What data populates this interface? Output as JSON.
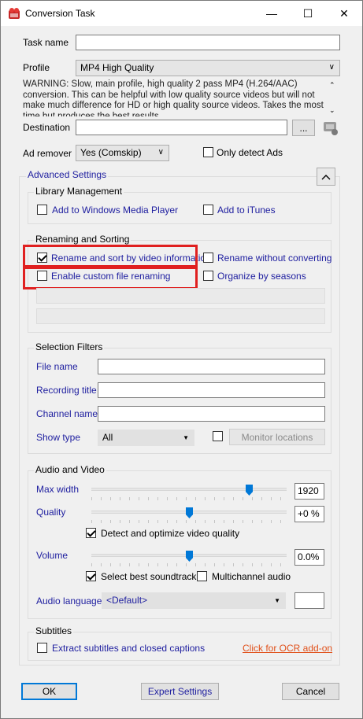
{
  "window": {
    "title": "Conversion Task",
    "minimize": "—",
    "maximize": "☐",
    "close": "✕"
  },
  "task_name": {
    "label": "Task name",
    "value": ""
  },
  "profile": {
    "label": "Profile",
    "value": "MP4 High Quality",
    "description": "WARNING: Slow, main profile, high quality 2 pass MP4 (H.264/AAC) conversion. This can be helpful with low quality source videos but will not make much difference for HD or high quality source videos. Takes the most time but produces the best results."
  },
  "destination": {
    "label": "Destination",
    "value": "",
    "browse": "..."
  },
  "ad_remover": {
    "label": "Ad remover",
    "value": "Yes (Comskip)",
    "only_detect": "Only detect Ads"
  },
  "advanced": {
    "label": "Advanced Settings",
    "collapse": "^"
  },
  "library": {
    "title": "Library Management",
    "wmp": "Add to Windows Media Player",
    "itunes": "Add to iTunes"
  },
  "renaming": {
    "title": "Renaming and Sorting",
    "rename_sort": "Rename and sort by video information",
    "rename_without": "Rename without converting",
    "custom": "Enable custom file renaming",
    "organize": "Organize by seasons"
  },
  "filters": {
    "title": "Selection Filters",
    "file_name": "File name",
    "recording_title": "Recording title",
    "channel_name": "Channel name",
    "show_type": "Show type",
    "show_type_value": "All",
    "monitor": "Monitor locations"
  },
  "av": {
    "title": "Audio and Video",
    "max_width": "Max width",
    "max_width_value": "1920",
    "max_width_level": 0.82,
    "quality": "Quality",
    "quality_value": "+0 %",
    "quality_level": 0.5,
    "detect": "Detect and optimize video quality",
    "volume": "Volume",
    "volume_value": "0.0%",
    "volume_level": 0.5,
    "soundtrack": "Select best soundtrack",
    "multichannel": "Multichannel audio",
    "audio_language": "Audio language",
    "audio_language_value": "<Default>"
  },
  "subtitles": {
    "title": "Subtitles",
    "extract": "Extract subtitles and closed captions",
    "ocr": "Click for OCR add-on"
  },
  "footer": {
    "ok": "OK",
    "expert": "Expert Settings",
    "cancel": "Cancel"
  },
  "colors": {
    "accent": "#0078d7",
    "highlight": "#e02020",
    "link": "#e0501a",
    "label_blue": "#2020a0"
  }
}
